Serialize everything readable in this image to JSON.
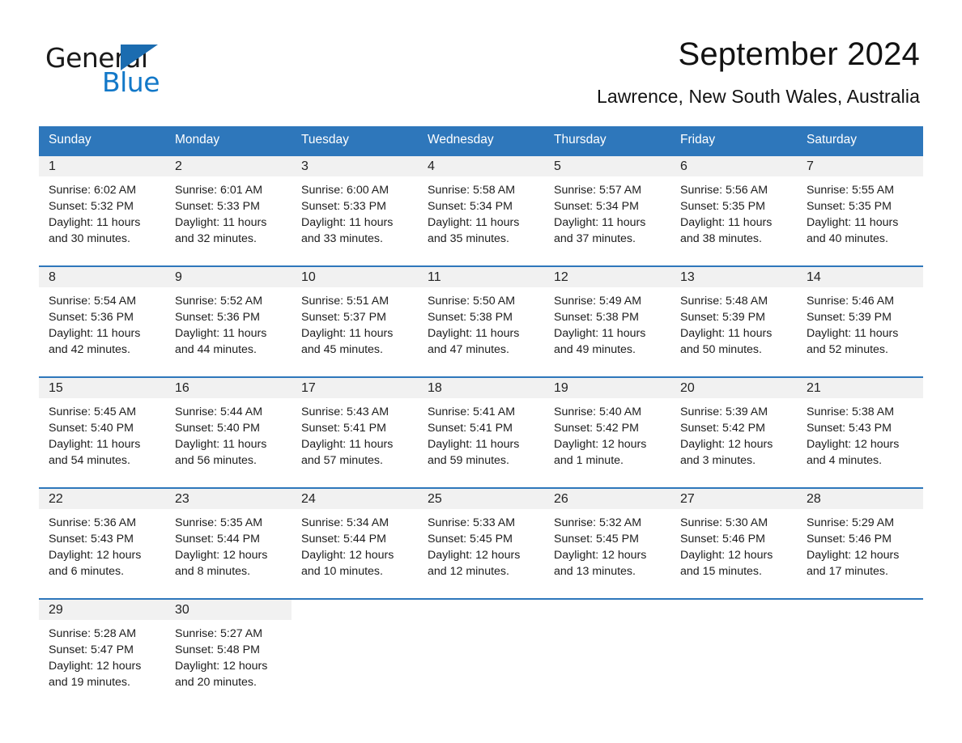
{
  "logo": {
    "word_one": "General",
    "word_two": "Blue",
    "triangle_color": "#1b6cb0",
    "blue_color": "#1278c8"
  },
  "header": {
    "month_title": "September 2024",
    "location": "Lawrence, New South Wales, Australia"
  },
  "theme": {
    "header_blue": "#2e77bb",
    "daynum_gray": "#f1f1f1",
    "text_dark": "#1c1c1c"
  },
  "weekdays": [
    "Sunday",
    "Monday",
    "Tuesday",
    "Wednesday",
    "Thursday",
    "Friday",
    "Saturday"
  ],
  "labels": {
    "sunrise_prefix": "Sunrise:",
    "sunset_prefix": "Sunset:",
    "daylight_prefix": "Daylight:"
  },
  "weeks": [
    [
      {
        "day": "1",
        "sunrise": "Sunrise: 6:02 AM",
        "sunset": "Sunset: 5:32 PM",
        "daylight_line1": "Daylight: 11 hours",
        "daylight_line2": "and 30 minutes."
      },
      {
        "day": "2",
        "sunrise": "Sunrise: 6:01 AM",
        "sunset": "Sunset: 5:33 PM",
        "daylight_line1": "Daylight: 11 hours",
        "daylight_line2": "and 32 minutes."
      },
      {
        "day": "3",
        "sunrise": "Sunrise: 6:00 AM",
        "sunset": "Sunset: 5:33 PM",
        "daylight_line1": "Daylight: 11 hours",
        "daylight_line2": "and 33 minutes."
      },
      {
        "day": "4",
        "sunrise": "Sunrise: 5:58 AM",
        "sunset": "Sunset: 5:34 PM",
        "daylight_line1": "Daylight: 11 hours",
        "daylight_line2": "and 35 minutes."
      },
      {
        "day": "5",
        "sunrise": "Sunrise: 5:57 AM",
        "sunset": "Sunset: 5:34 PM",
        "daylight_line1": "Daylight: 11 hours",
        "daylight_line2": "and 37 minutes."
      },
      {
        "day": "6",
        "sunrise": "Sunrise: 5:56 AM",
        "sunset": "Sunset: 5:35 PM",
        "daylight_line1": "Daylight: 11 hours",
        "daylight_line2": "and 38 minutes."
      },
      {
        "day": "7",
        "sunrise": "Sunrise: 5:55 AM",
        "sunset": "Sunset: 5:35 PM",
        "daylight_line1": "Daylight: 11 hours",
        "daylight_line2": "and 40 minutes."
      }
    ],
    [
      {
        "day": "8",
        "sunrise": "Sunrise: 5:54 AM",
        "sunset": "Sunset: 5:36 PM",
        "daylight_line1": "Daylight: 11 hours",
        "daylight_line2": "and 42 minutes."
      },
      {
        "day": "9",
        "sunrise": "Sunrise: 5:52 AM",
        "sunset": "Sunset: 5:36 PM",
        "daylight_line1": "Daylight: 11 hours",
        "daylight_line2": "and 44 minutes."
      },
      {
        "day": "10",
        "sunrise": "Sunrise: 5:51 AM",
        "sunset": "Sunset: 5:37 PM",
        "daylight_line1": "Daylight: 11 hours",
        "daylight_line2": "and 45 minutes."
      },
      {
        "day": "11",
        "sunrise": "Sunrise: 5:50 AM",
        "sunset": "Sunset: 5:38 PM",
        "daylight_line1": "Daylight: 11 hours",
        "daylight_line2": "and 47 minutes."
      },
      {
        "day": "12",
        "sunrise": "Sunrise: 5:49 AM",
        "sunset": "Sunset: 5:38 PM",
        "daylight_line1": "Daylight: 11 hours",
        "daylight_line2": "and 49 minutes."
      },
      {
        "day": "13",
        "sunrise": "Sunrise: 5:48 AM",
        "sunset": "Sunset: 5:39 PM",
        "daylight_line1": "Daylight: 11 hours",
        "daylight_line2": "and 50 minutes."
      },
      {
        "day": "14",
        "sunrise": "Sunrise: 5:46 AM",
        "sunset": "Sunset: 5:39 PM",
        "daylight_line1": "Daylight: 11 hours",
        "daylight_line2": "and 52 minutes."
      }
    ],
    [
      {
        "day": "15",
        "sunrise": "Sunrise: 5:45 AM",
        "sunset": "Sunset: 5:40 PM",
        "daylight_line1": "Daylight: 11 hours",
        "daylight_line2": "and 54 minutes."
      },
      {
        "day": "16",
        "sunrise": "Sunrise: 5:44 AM",
        "sunset": "Sunset: 5:40 PM",
        "daylight_line1": "Daylight: 11 hours",
        "daylight_line2": "and 56 minutes."
      },
      {
        "day": "17",
        "sunrise": "Sunrise: 5:43 AM",
        "sunset": "Sunset: 5:41 PM",
        "daylight_line1": "Daylight: 11 hours",
        "daylight_line2": "and 57 minutes."
      },
      {
        "day": "18",
        "sunrise": "Sunrise: 5:41 AM",
        "sunset": "Sunset: 5:41 PM",
        "daylight_line1": "Daylight: 11 hours",
        "daylight_line2": "and 59 minutes."
      },
      {
        "day": "19",
        "sunrise": "Sunrise: 5:40 AM",
        "sunset": "Sunset: 5:42 PM",
        "daylight_line1": "Daylight: 12 hours",
        "daylight_line2": "and 1 minute."
      },
      {
        "day": "20",
        "sunrise": "Sunrise: 5:39 AM",
        "sunset": "Sunset: 5:42 PM",
        "daylight_line1": "Daylight: 12 hours",
        "daylight_line2": "and 3 minutes."
      },
      {
        "day": "21",
        "sunrise": "Sunrise: 5:38 AM",
        "sunset": "Sunset: 5:43 PM",
        "daylight_line1": "Daylight: 12 hours",
        "daylight_line2": "and 4 minutes."
      }
    ],
    [
      {
        "day": "22",
        "sunrise": "Sunrise: 5:36 AM",
        "sunset": "Sunset: 5:43 PM",
        "daylight_line1": "Daylight: 12 hours",
        "daylight_line2": "and 6 minutes."
      },
      {
        "day": "23",
        "sunrise": "Sunrise: 5:35 AM",
        "sunset": "Sunset: 5:44 PM",
        "daylight_line1": "Daylight: 12 hours",
        "daylight_line2": "and 8 minutes."
      },
      {
        "day": "24",
        "sunrise": "Sunrise: 5:34 AM",
        "sunset": "Sunset: 5:44 PM",
        "daylight_line1": "Daylight: 12 hours",
        "daylight_line2": "and 10 minutes."
      },
      {
        "day": "25",
        "sunrise": "Sunrise: 5:33 AM",
        "sunset": "Sunset: 5:45 PM",
        "daylight_line1": "Daylight: 12 hours",
        "daylight_line2": "and 12 minutes."
      },
      {
        "day": "26",
        "sunrise": "Sunrise: 5:32 AM",
        "sunset": "Sunset: 5:45 PM",
        "daylight_line1": "Daylight: 12 hours",
        "daylight_line2": "and 13 minutes."
      },
      {
        "day": "27",
        "sunrise": "Sunrise: 5:30 AM",
        "sunset": "Sunset: 5:46 PM",
        "daylight_line1": "Daylight: 12 hours",
        "daylight_line2": "and 15 minutes."
      },
      {
        "day": "28",
        "sunrise": "Sunrise: 5:29 AM",
        "sunset": "Sunset: 5:46 PM",
        "daylight_line1": "Daylight: 12 hours",
        "daylight_line2": "and 17 minutes."
      }
    ],
    [
      {
        "day": "29",
        "sunrise": "Sunrise: 5:28 AM",
        "sunset": "Sunset: 5:47 PM",
        "daylight_line1": "Daylight: 12 hours",
        "daylight_line2": "and 19 minutes."
      },
      {
        "day": "30",
        "sunrise": "Sunrise: 5:27 AM",
        "sunset": "Sunset: 5:48 PM",
        "daylight_line1": "Daylight: 12 hours",
        "daylight_line2": "and 20 minutes."
      },
      {
        "day": "",
        "sunrise": "",
        "sunset": "",
        "daylight_line1": "",
        "daylight_line2": ""
      },
      {
        "day": "",
        "sunrise": "",
        "sunset": "",
        "daylight_line1": "",
        "daylight_line2": ""
      },
      {
        "day": "",
        "sunrise": "",
        "sunset": "",
        "daylight_line1": "",
        "daylight_line2": ""
      },
      {
        "day": "",
        "sunrise": "",
        "sunset": "",
        "daylight_line1": "",
        "daylight_line2": ""
      },
      {
        "day": "",
        "sunrise": "",
        "sunset": "",
        "daylight_line1": "",
        "daylight_line2": ""
      }
    ]
  ]
}
